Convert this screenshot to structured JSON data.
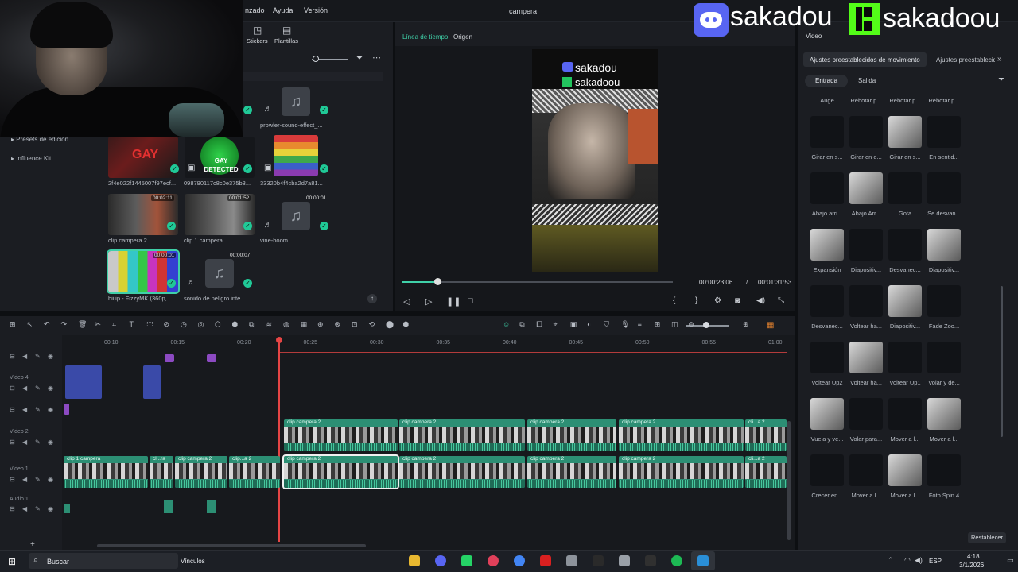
{
  "menubar": {
    "items": [
      "nzado",
      "Ayuda",
      "Versión"
    ],
    "title": "campera"
  },
  "overlay": {
    "name1": "sakadou",
    "name2": "sakadoou"
  },
  "toolbar": {
    "stickers": "Stickers",
    "plantillas": "Plantillas",
    "video_tab": "Video"
  },
  "left_panel": {
    "items": [
      "Presets de edición",
      "Influence Kit"
    ]
  },
  "media": {
    "items": [
      {
        "label": "prowler-sound-effect_...",
        "duration": ""
      },
      {
        "label": "2f4e022f1445007f97ecf...",
        "duration": ""
      },
      {
        "label": "098790117c8c0e375b3...",
        "duration": ""
      },
      {
        "label": "33320b4f4cba2d7a81...",
        "duration": ""
      },
      {
        "label": "clip campera 2",
        "duration": "00:02:11"
      },
      {
        "label": "clip 1 campera",
        "duration": "00:01:52"
      },
      {
        "label": "vine-boom",
        "duration": "00:00:01"
      },
      {
        "label": "biiiip - FizzyMK (360p, ...",
        "duration": "00:00:01"
      },
      {
        "label": "sonido de peligro inte...",
        "duration": "00:00:07"
      }
    ]
  },
  "preview": {
    "tabs": [
      "Línea de tiempo",
      "Origen"
    ],
    "current_time": "00:00:23:06",
    "separator": "/",
    "total_time": "00:01:31:53",
    "progress": 0.13,
    "video_text1": "sakadou",
    "video_text2": "sakadoou"
  },
  "right_panel": {
    "tabs": [
      "Ajustes preestablecidos de movimiento",
      "Ajustes preestablecid"
    ],
    "subtabs": [
      "Entrada",
      "Salida"
    ],
    "effects": [
      "Auge",
      "Rebotar p...",
      "Rebotar p...",
      "Rebotar p...",
      "Girar en s...",
      "Girar en e...",
      "Girar en s...",
      "En sentid...",
      "Abajo arri...",
      "Abajo Arr...",
      "Gota",
      "Se desvan...",
      "Expansión",
      "Diapositiv...",
      "Desvanec...",
      "Diapositiv...",
      "Desvanec...",
      "Voltear ha...",
      "Diapositiv...",
      "Fade Zoo...",
      "Voltear Up2",
      "Voltear ha...",
      "Voltear Up1",
      "Volar y de...",
      "Vuela y ve...",
      "Volar para...",
      "Mover a l...",
      "Mover a l...",
      "Crecer en...",
      "Mover a l...",
      "Mover a l...",
      "Foto Spin 4"
    ],
    "reset": "Restablecer"
  },
  "timeline": {
    "ruler": [
      "00:10",
      "00:15",
      "00:20",
      "00:25",
      "00:30",
      "00:35",
      "00:40",
      "00:45",
      "00:50",
      "00:55",
      "01:00"
    ],
    "tracks": [
      "Video 4",
      "Video 2",
      "Video 1",
      "Audio 1"
    ],
    "clip_labels": {
      "v2": [
        "clip campera 2",
        "clip campera 2",
        "clip campera 2",
        "clip campera 2",
        "cli...a 2"
      ],
      "v1": [
        "clip 1 campera",
        "cl...ra",
        "clip campera 2",
        "clip...a 2",
        "clip campera 2",
        "clip campera 2",
        "clip campera 2",
        "clip campera 2",
        "cli...a 2"
      ]
    }
  },
  "taskbar": {
    "search": "Buscar",
    "vinculos": "Vínculos",
    "lang": "ESP",
    "time": "4:18",
    "date": "3/1/2026"
  }
}
